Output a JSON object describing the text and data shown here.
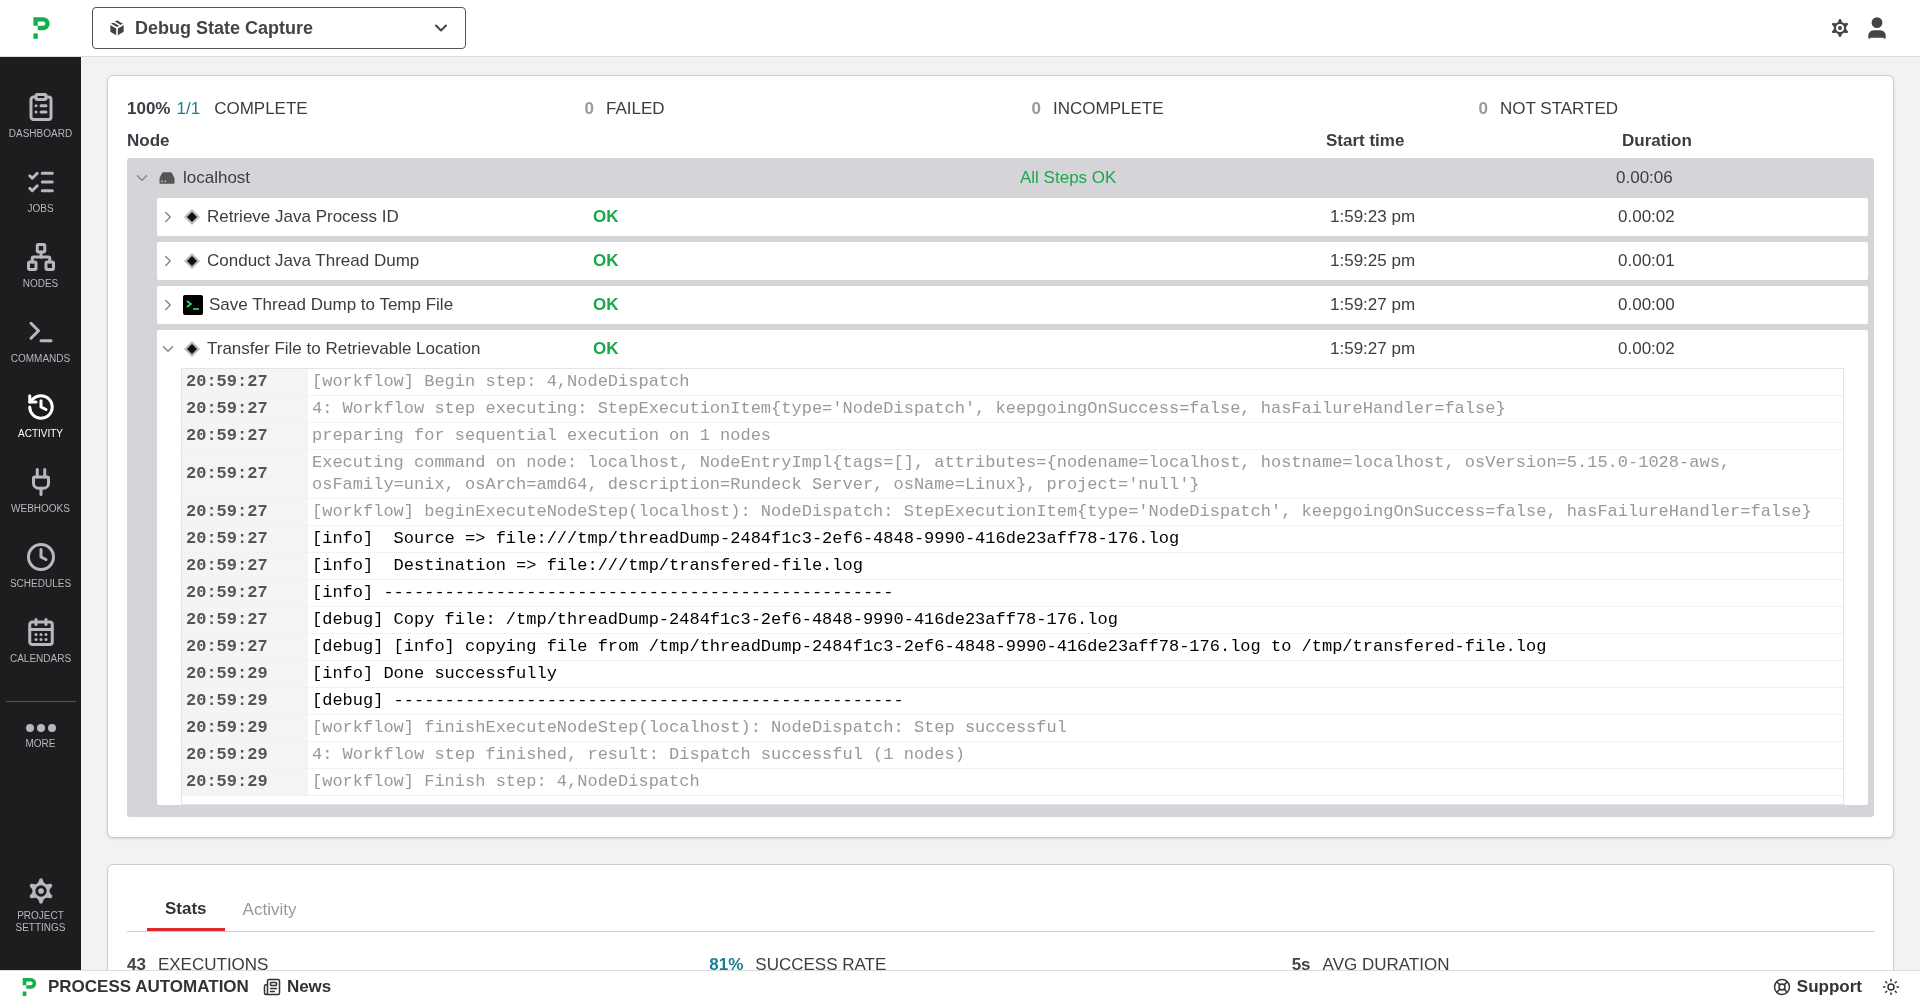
{
  "header": {
    "project": "Debug State Capture"
  },
  "sidebar": {
    "items": [
      {
        "label": "DASHBOARD",
        "selected": false
      },
      {
        "label": "JOBS",
        "selected": false
      },
      {
        "label": "NODES",
        "selected": false
      },
      {
        "label": "COMMANDS",
        "selected": false
      },
      {
        "label": "ACTIVITY",
        "selected": true
      },
      {
        "label": "WEBHOOKS",
        "selected": false
      },
      {
        "label": "SCHEDULES",
        "selected": false
      },
      {
        "label": "CALENDARS",
        "selected": false
      }
    ],
    "more": "MORE",
    "settings": [
      "PROJECT",
      "SETTINGS"
    ]
  },
  "summary": {
    "percent": "100%",
    "fraction": "1/1",
    "complete": "COMPLETE",
    "failed_count": "0",
    "failed": "FAILED",
    "incomplete_count": "0",
    "incomplete": "INCOMPLETE",
    "not_started_count": "0",
    "not_started": "NOT STARTED"
  },
  "table": {
    "columns": [
      "Node",
      "Start time",
      "Duration"
    ],
    "node": {
      "name": "localhost",
      "expanded": true,
      "status": "All Steps OK",
      "duration": "0.00:06"
    },
    "steps": [
      {
        "name": "Retrieve Java Process ID",
        "kind": "workflow",
        "status": "OK",
        "start": "1:59:23 pm",
        "duration": "0.00:02",
        "expanded": false
      },
      {
        "name": "Conduct Java Thread Dump",
        "kind": "workflow",
        "status": "OK",
        "start": "1:59:25 pm",
        "duration": "0.00:01",
        "expanded": false
      },
      {
        "name": "Save Thread Dump to Temp File",
        "kind": "command",
        "status": "OK",
        "start": "1:59:27 pm",
        "duration": "0.00:00",
        "expanded": false
      },
      {
        "name": "Transfer File to Retrievable Location",
        "kind": "workflow",
        "status": "OK",
        "start": "1:59:27 pm",
        "duration": "0.00:02",
        "expanded": true
      }
    ]
  },
  "log": [
    {
      "time": "20:59:27",
      "kind": "system",
      "text": "[workflow] Begin step: 4,NodeDispatch"
    },
    {
      "time": "20:59:27",
      "kind": "system",
      "text": "4: Workflow step executing: StepExecutionItem{type='NodeDispatch', keepgoingOnSuccess=false, hasFailureHandler=false}"
    },
    {
      "time": "20:59:27",
      "kind": "system",
      "text": "preparing for sequential execution on 1 nodes"
    },
    {
      "time": "20:59:27",
      "kind": "system",
      "text": "Executing command on node: localhost, NodeEntryImpl{tags=[], attributes={nodename=localhost, hostname=localhost, osVersion=5.15.0-1028-aws, osFamily=unix, osArch=amd64, description=Rundeck Server, osName=Linux}, project='null'}"
    },
    {
      "time": "20:59:27",
      "kind": "system",
      "text": "[workflow] beginExecuteNodeStep(localhost): NodeDispatch: StepExecutionItem{type='NodeDispatch', keepgoingOnSuccess=false, hasFailureHandler=false}"
    },
    {
      "time": "20:59:27",
      "kind": "output",
      "text": "[info]  Source => file:///tmp/threadDump-2484f1c3-2ef6-4848-9990-416de23aff78-176.log"
    },
    {
      "time": "20:59:27",
      "kind": "output",
      "text": "[info]  Destination => file:///tmp/transfered-file.log"
    },
    {
      "time": "20:59:27",
      "kind": "output",
      "text": "[info] --------------------------------------------------"
    },
    {
      "time": "20:59:27",
      "kind": "output",
      "text": "[debug] Copy file: /tmp/threadDump-2484f1c3-2ef6-4848-9990-416de23aff78-176.log"
    },
    {
      "time": "20:59:27",
      "kind": "output",
      "text": "[debug] [info] copying file from /tmp/threadDump-2484f1c3-2ef6-4848-9990-416de23aff78-176.log to /tmp/transfered-file.log"
    },
    {
      "time": "20:59:29",
      "kind": "output",
      "text": "[info] Done successfully"
    },
    {
      "time": "20:59:29",
      "kind": "output",
      "text": "[debug] --------------------------------------------------"
    },
    {
      "time": "20:59:29",
      "kind": "system",
      "text": "[workflow] finishExecuteNodeStep(localhost): NodeDispatch: Step successful"
    },
    {
      "time": "20:59:29",
      "kind": "system",
      "text": "4: Workflow step finished, result: Dispatch successful (1 nodes)"
    },
    {
      "time": "20:59:29",
      "kind": "system",
      "text": "[workflow] Finish step: 4,NodeDispatch"
    }
  ],
  "stats": {
    "tabs": [
      {
        "label": "Stats",
        "selected": true
      },
      {
        "label": "Activity",
        "selected": false
      }
    ],
    "items": [
      {
        "value": "43",
        "label": "EXECUTIONS",
        "kind": "plain"
      },
      {
        "value": "81%",
        "label": "SUCCESS RATE",
        "kind": "accent"
      },
      {
        "value": "5s",
        "label": "AVG DURATION",
        "kind": "plain"
      }
    ]
  },
  "footer": {
    "brand": "PROCESS AUTOMATION",
    "news": "News",
    "support": "Support"
  }
}
